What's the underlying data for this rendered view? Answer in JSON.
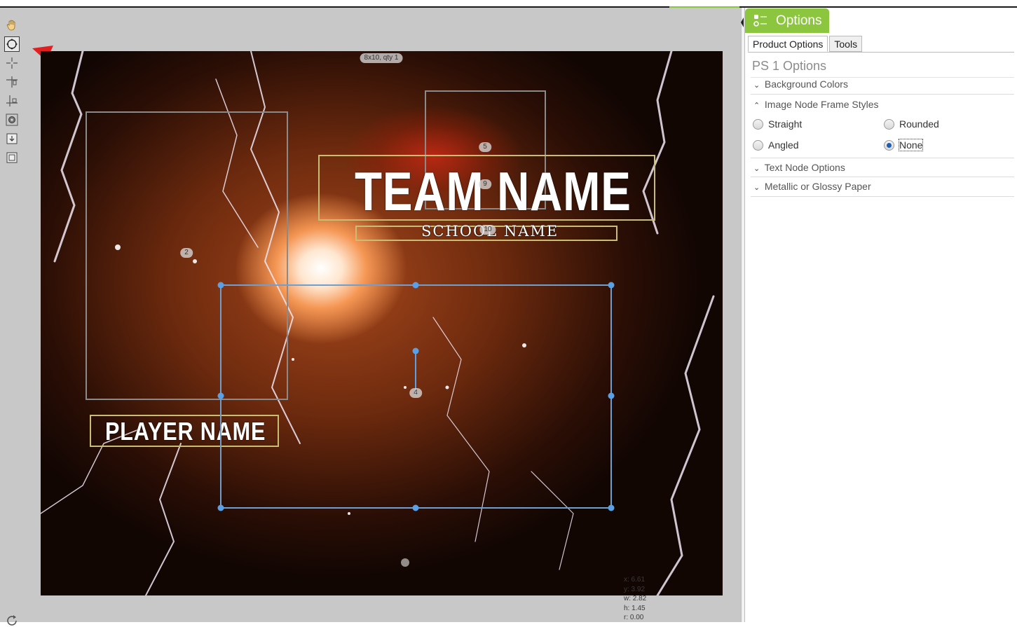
{
  "canvas": {
    "size_badge": "8x10, qty 1",
    "team_name": "TEAM NAME",
    "school_name": "SCHOOL NAME",
    "player_name": "PLAYER NAME",
    "node_badges": [
      "5",
      "9",
      "10",
      "2",
      "4"
    ],
    "readout": {
      "x": "x: 6.61",
      "y": "y: 3.92",
      "w": "w: 2.82",
      "h": "h: 1.45",
      "r": "r: 0.00"
    }
  },
  "toolbar": {
    "tools": [
      "hand-icon",
      "move-icon",
      "crop-icon",
      "align-top-icon",
      "align-bottom-icon",
      "settings-icon",
      "bring-forward-icon",
      "send-back-icon"
    ]
  },
  "panel": {
    "button_label": "Options",
    "tabs": [
      "Product Options",
      "Tools"
    ],
    "title": "PS 1 Options",
    "sections": {
      "background": "Background Colors",
      "frame_styles": "Image Node Frame Styles",
      "text_node": "Text Node Options",
      "paper": "Metallic or Glossy Paper"
    },
    "frame_options": {
      "straight": "Straight",
      "rounded": "Rounded",
      "angled": "Angled",
      "none": "None",
      "selected": "None"
    }
  },
  "colors": {
    "accent": "#8cc63f",
    "selection": "#5aa0e6",
    "text_frame": "#c9bd74",
    "arrow": "#e02020"
  }
}
